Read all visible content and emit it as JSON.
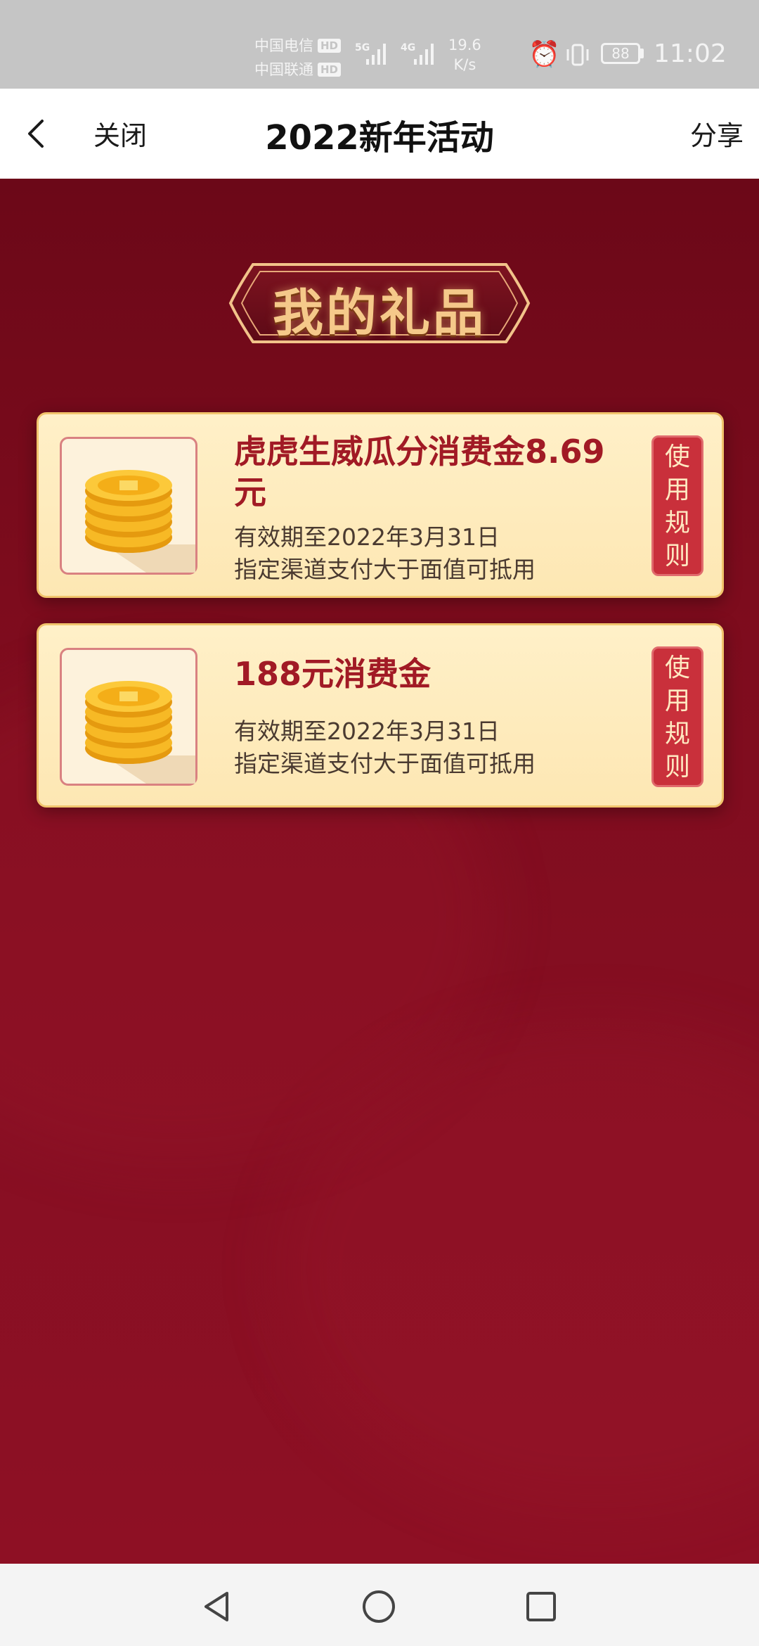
{
  "status_bar": {
    "carrier1": "中国电信",
    "carrier2": "中国联通",
    "hd_label": "HD",
    "net1": "5G",
    "net2": "4G",
    "speed_value": "19.6",
    "speed_unit": "K/s",
    "battery": "88",
    "time": "11:02"
  },
  "header": {
    "close_label": "关闭",
    "title": "2022新年活动",
    "share_label": "分享"
  },
  "banner": {
    "title": "我的礼品"
  },
  "gifts": [
    {
      "title": "虎虎生威瓜分消费金8.69元",
      "validity": "有效期至2022年3月31日",
      "note": "指定渠道支付大于面值可抵用",
      "rules": [
        "使",
        "用",
        "规",
        "则"
      ]
    },
    {
      "title": "188元消费金",
      "validity": "有效期至2022年3月31日",
      "note": "指定渠道支付大于面值可抵用",
      "rules": [
        "使",
        "用",
        "规",
        "则"
      ]
    }
  ],
  "colors": {
    "background": "#8a0f22",
    "card_title": "#a11a25",
    "rules_button": "#c9303b",
    "banner_text": "#f5c98a"
  }
}
